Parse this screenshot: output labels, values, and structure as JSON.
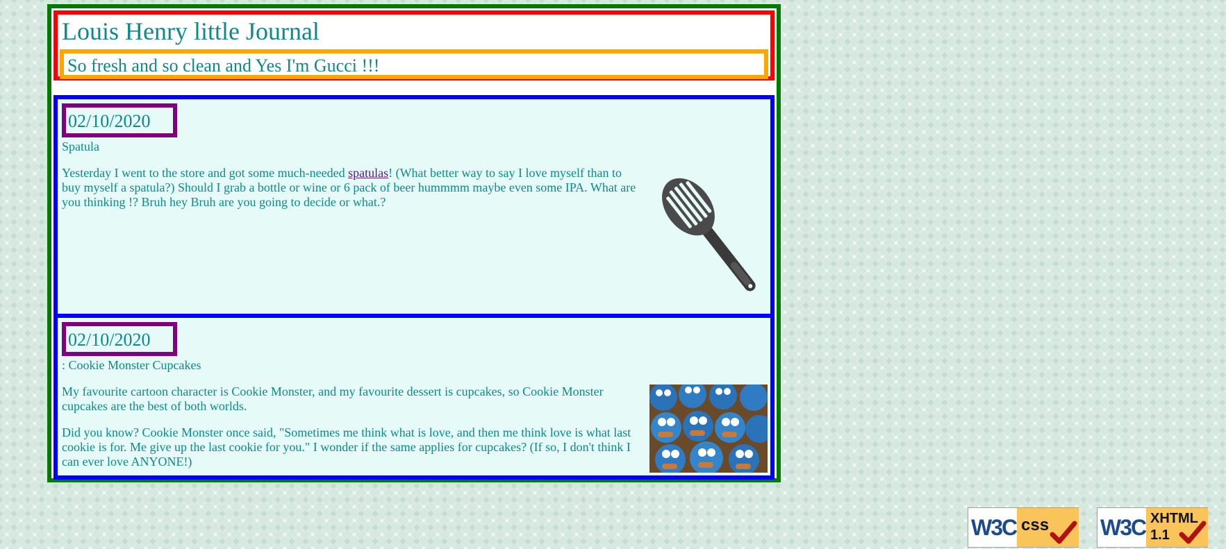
{
  "header": {
    "title": "Louis Henry little Journal",
    "tagline": "So fresh and so clean and Yes I'm Gucci !!!"
  },
  "posts": [
    {
      "date": "02/10/2020",
      "title": "Spatula",
      "body_before_link": "Yesterday I went to the store and got some much-needed ",
      "link_text": "spatulas",
      "body_after_link": "! (What better way to say I love myself than to buy myself a spatula?) Should I grab a bottle or wine or 6 pack of beer hummmm maybe even some IPA. What are you thinking !? Bruh hey Bruh are you going to decide or what.?",
      "image": "spatula-image"
    },
    {
      "date": "02/10/2020",
      "title": ": Cookie Monster Cupcakes",
      "paragraphs": [
        "My favourite cartoon character is Cookie Monster, and my favourite dessert is cupcakes, so Cookie Monster cupcakes are the best of both worlds.",
        "Did you know? Cookie Monster once said, \"Sometimes me think what is love, and then me think love is what last cookie is for. Me give up the last cookie for you.\" I wonder if the same applies for cupcakes? (If so, I don't think I can ever love ANYONE!)"
      ],
      "image": "cookie-monster-cupcakes-image"
    }
  ],
  "badges": {
    "css": {
      "logo": "W3C",
      "label": "css"
    },
    "xhtml": {
      "logo": "W3C",
      "label_top": "XHTML",
      "label_bottom": "1.1"
    }
  },
  "colors": {
    "page_border": "#007a00",
    "header_border": "#ff0000",
    "tagline_border": "#ffa500",
    "post_border": "#0000ff",
    "date_border": "#800080",
    "text": "#0c8a8a",
    "post_background": "#e6faf8",
    "link": "#551a8b"
  }
}
